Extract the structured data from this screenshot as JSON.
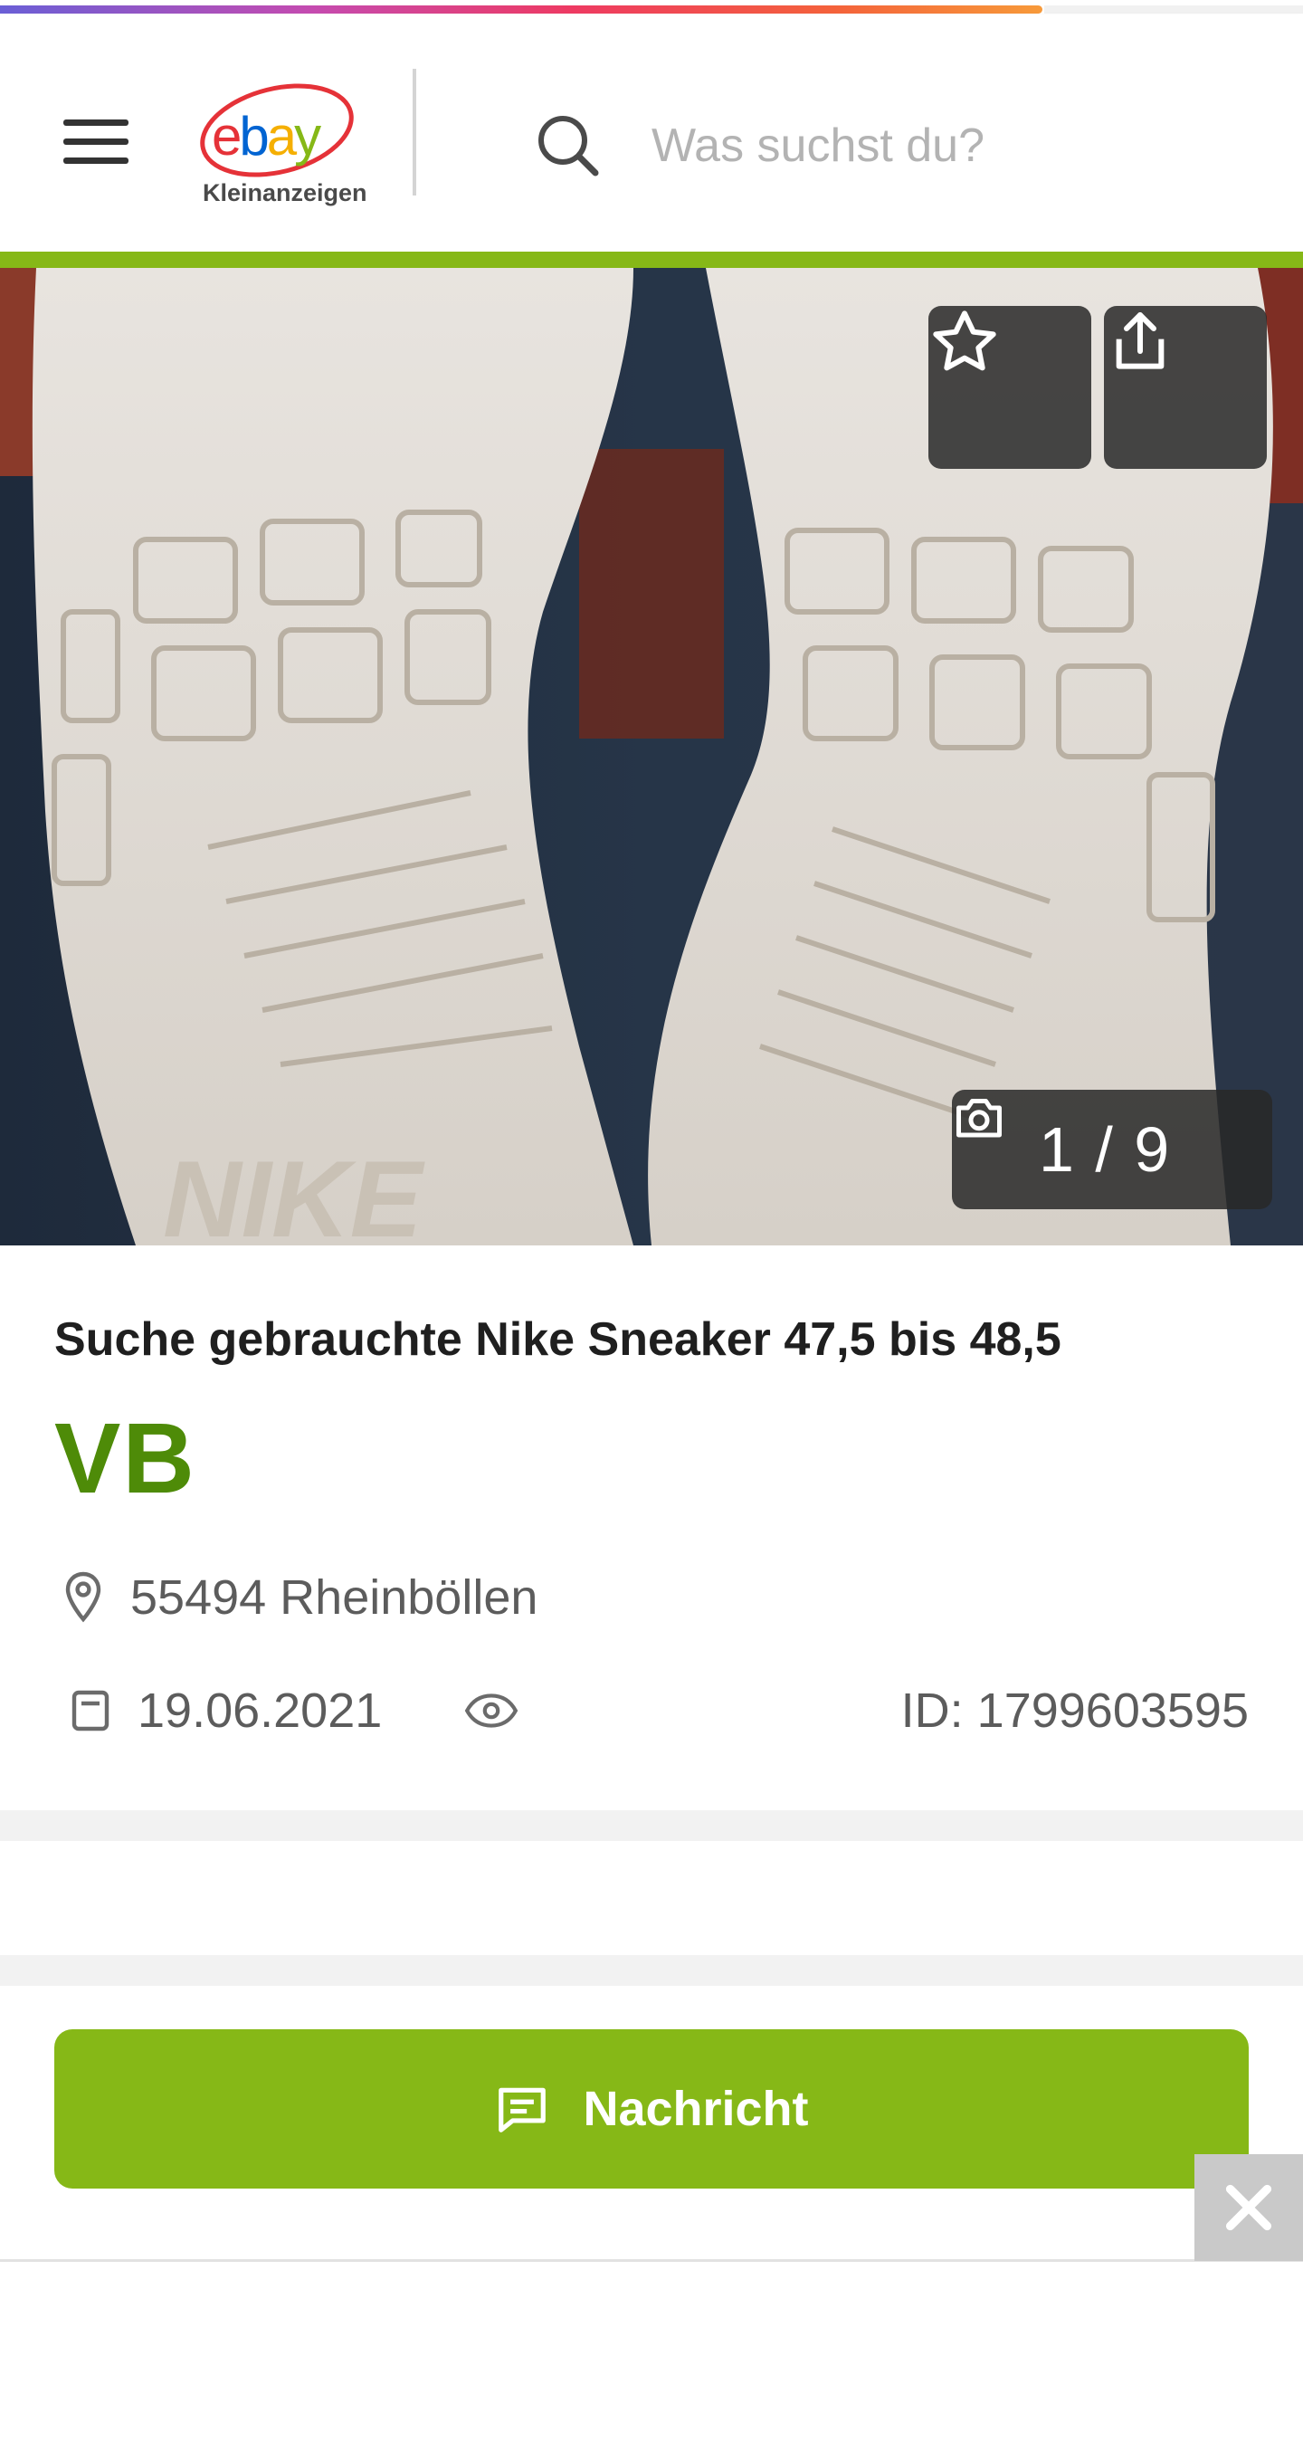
{
  "header": {
    "logo": {
      "brand": "ebay",
      "sub": "Kleinanzeigen"
    },
    "search": {
      "placeholder": "Was suchst du?"
    },
    "icons": [
      "menu-icon",
      "search-icon"
    ]
  },
  "page_load_progress": 0.8,
  "gallery": {
    "photo_counter": "1 / 9",
    "icons": [
      "star-icon",
      "share-icon",
      "camera-icon"
    ],
    "watermark_text": "NIKE"
  },
  "listing": {
    "title": "Suche gebrauchte Nike Sneaker 47,5 bis 48,5",
    "price": "VB",
    "location": "55494 Rheinböllen",
    "date": "19.06.2021",
    "ad_id": "ID: 1799603595"
  },
  "actions": {
    "message_label": "Nachricht"
  },
  "colors": {
    "brand_green": "#86b817",
    "price_green": "#4e8b08",
    "logo_e": "#e53238",
    "logo_b": "#0064d2",
    "logo_a": "#f5af02",
    "logo_y": "#86b817"
  }
}
